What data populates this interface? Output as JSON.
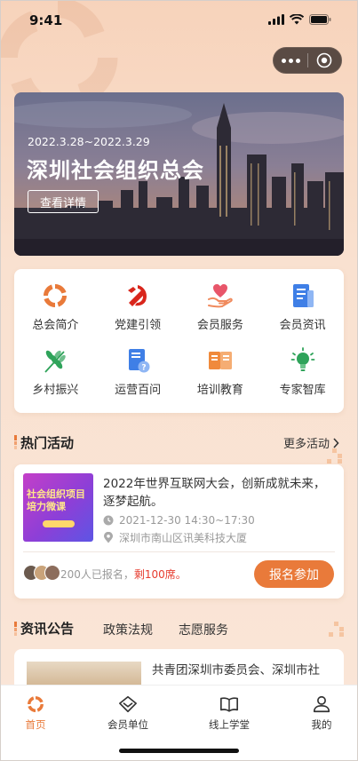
{
  "status_bar": {
    "time": "9:41"
  },
  "banner": {
    "date": "2022.3.28~2022.3.29",
    "title": "深圳社会组织总会",
    "button": "查看详情"
  },
  "menu": {
    "items": [
      {
        "label": "总会简介",
        "icon": "org-logo-icon"
      },
      {
        "label": "党建引领",
        "icon": "party-emblem-icon"
      },
      {
        "label": "会员服务",
        "icon": "heart-hand-icon"
      },
      {
        "label": "会员资讯",
        "icon": "news-doc-icon"
      },
      {
        "label": "乡村振兴",
        "icon": "wheat-icon"
      },
      {
        "label": "运营百问",
        "icon": "question-book-icon"
      },
      {
        "label": "培训教育",
        "icon": "training-book-icon"
      },
      {
        "label": "专家智库",
        "icon": "lightbulb-icon"
      }
    ]
  },
  "hot_activities": {
    "title": "热门活动",
    "more": "更多活动",
    "card": {
      "thumb_text": "社会组织项目\n培力微课",
      "title": "2022年世界互联网大会，创新成就未来，逐梦起航。",
      "time": "2021-12-30  14:30~17:30",
      "location": "深圳市南山区讯美科技大厦",
      "signup_count": "200人已报名，",
      "remaining": "剩100席。",
      "button": "报名参加"
    }
  },
  "news": {
    "tabs": [
      "资讯公告",
      "政策法规",
      "志愿服务"
    ],
    "active_tab": 0,
    "first_item_title": "共青团深圳市委员会、深圳市社"
  },
  "tab_bar": {
    "items": [
      {
        "label": "首页",
        "icon": "home-logo-icon",
        "active": true
      },
      {
        "label": "会员单位",
        "icon": "diamond-icon",
        "active": false
      },
      {
        "label": "线上学堂",
        "icon": "open-book-icon",
        "active": false
      },
      {
        "label": "我的",
        "icon": "user-icon",
        "active": false
      }
    ]
  },
  "colors": {
    "accent": "#e97a3a",
    "highlight": "#e63b2e",
    "background": "#f8dcc7"
  }
}
